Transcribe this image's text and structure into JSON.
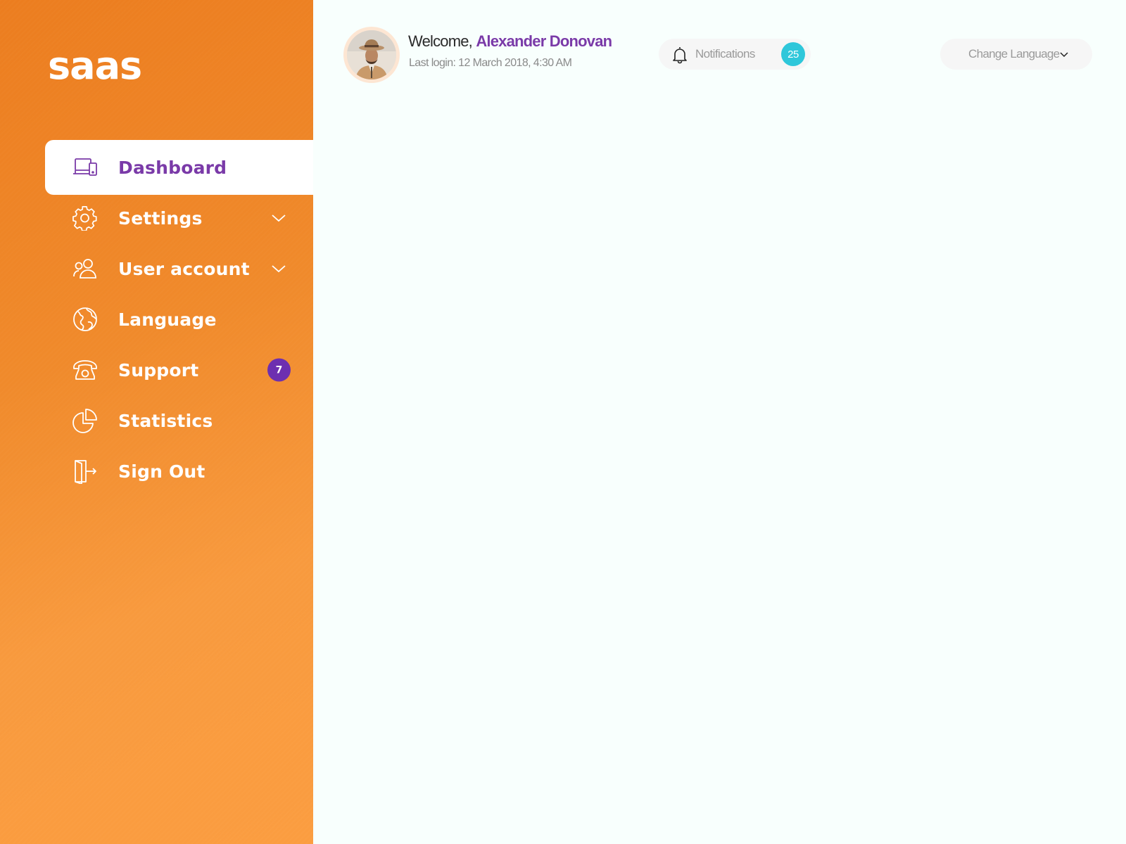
{
  "app": {
    "logo": "saas"
  },
  "sidebar": {
    "items": [
      {
        "label": "Dashboard",
        "icon": "devices-icon",
        "active": true
      },
      {
        "label": "Settings",
        "icon": "gear-icon",
        "has_submenu": true
      },
      {
        "label": "User account",
        "icon": "users-icon",
        "has_submenu": true
      },
      {
        "label": "Language",
        "icon": "globe-icon"
      },
      {
        "label": "Support",
        "icon": "phone-icon",
        "badge": "7"
      },
      {
        "label": "Statistics",
        "icon": "pie-chart-icon"
      },
      {
        "label": "Sign Out",
        "icon": "sign-out-icon"
      }
    ]
  },
  "header": {
    "welcome_prefix": "Welcome,",
    "user_name": "Alexander Donovan",
    "last_login": "Last login: 12 March 2018, 4:30 AM",
    "notifications": {
      "label": "Notifications",
      "count": "25",
      "icon": "bell-icon"
    },
    "language": {
      "label": "Change Language",
      "icon": "chevron-down-icon"
    }
  },
  "colors": {
    "sidebar_gradient_start": "#ec7d1f",
    "sidebar_gradient_end": "#fb9d40",
    "accent_purple": "#7a3aa8",
    "badge_purple": "#6d2fb0",
    "notification_teal": "#2fc7da",
    "content_background": "#f8fffd"
  }
}
